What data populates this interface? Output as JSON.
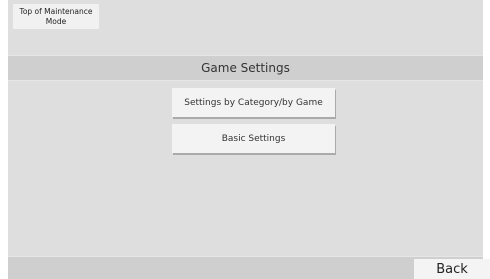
{
  "header": {
    "top_button_label_line1": "Top of Maintenance",
    "top_button_label_line2": "Mode"
  },
  "main": {
    "title": "Game Settings",
    "menu": [
      {
        "label": "Settings by Category/by Game"
      },
      {
        "label": "Basic Settings"
      }
    ]
  },
  "footer": {
    "back_label": "Back"
  }
}
